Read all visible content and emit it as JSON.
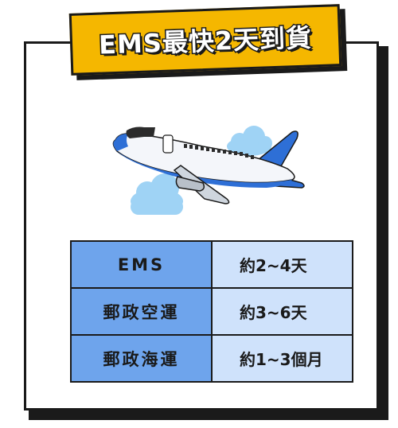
{
  "banner": {
    "title": "EMS最快2天到貨"
  },
  "illustration": {
    "icon": "airplane-icon"
  },
  "shipping_table": {
    "rows": [
      {
        "method": "EMS",
        "time": "約2~4天"
      },
      {
        "method": "郵政空運",
        "time": "約3~6天"
      },
      {
        "method": "郵政海運",
        "time": "約1~3個月"
      }
    ]
  },
  "colors": {
    "banner": "#f5b700",
    "method_cell": "#6ea4ec",
    "time_cell": "#cfe2fb",
    "border": "#1a1a1a",
    "plane_blue": "#2e6fd6",
    "cloud": "#9fd3f5"
  }
}
